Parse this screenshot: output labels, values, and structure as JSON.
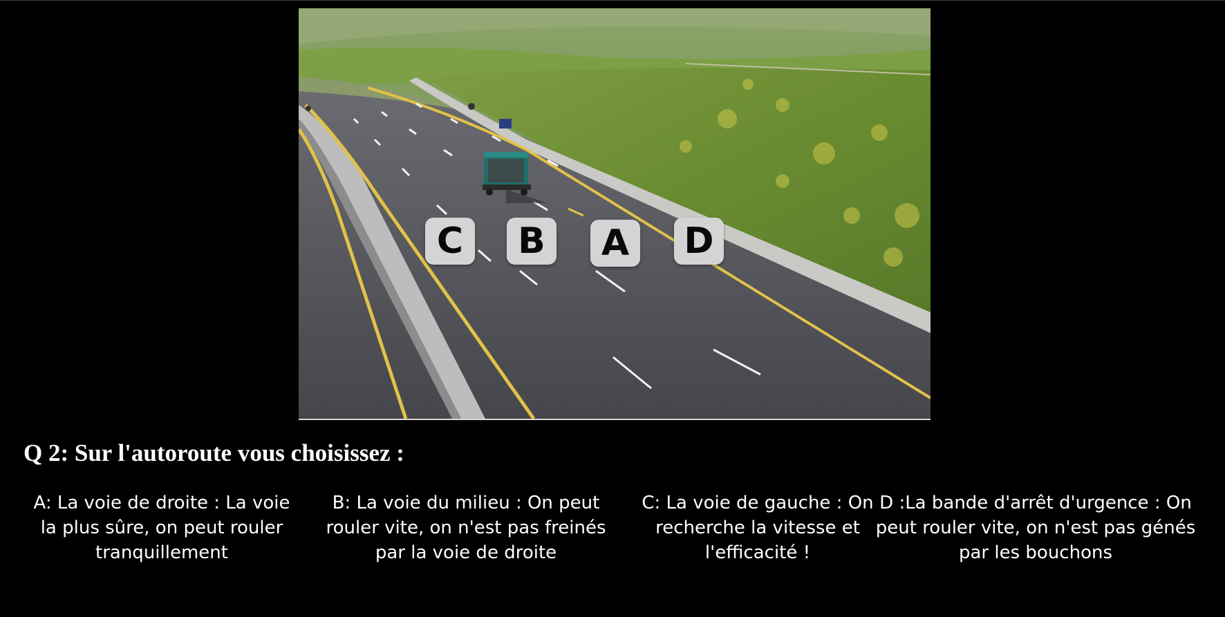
{
  "scene": {
    "lane_labels": [
      "C",
      "B",
      "A",
      "D"
    ],
    "colors": {
      "sky_field": "#7c9a4a",
      "grass": "#6e8f3a",
      "asphalt": "#4d4e53",
      "median_barrier": "#bdbdbd",
      "edge_line": "#e3c14a",
      "lane_dash": "#f2f2f2",
      "truck_cab": "#1f6e6a",
      "badge": "#d4d4d4"
    }
  },
  "question": {
    "text": "Q 2: Sur l'autoroute vous choisissez :"
  },
  "answers": [
    {
      "key": "A",
      "text": "A: La voie de droite : La voie la plus sûre, on peut rouler tranquillement"
    },
    {
      "key": "B",
      "text": "B: La voie du milieu : On peut rouler vite, on n'est pas freinés par la voie de droite"
    },
    {
      "key": "C",
      "text": "C: La voie de gauche : On recherche la vitesse et l'efficacité !"
    },
    {
      "key": "D",
      "text": "D :La bande d'arrêt d'urgence : On peut rouler vite, on n'est pas génés par les bouchons"
    }
  ]
}
